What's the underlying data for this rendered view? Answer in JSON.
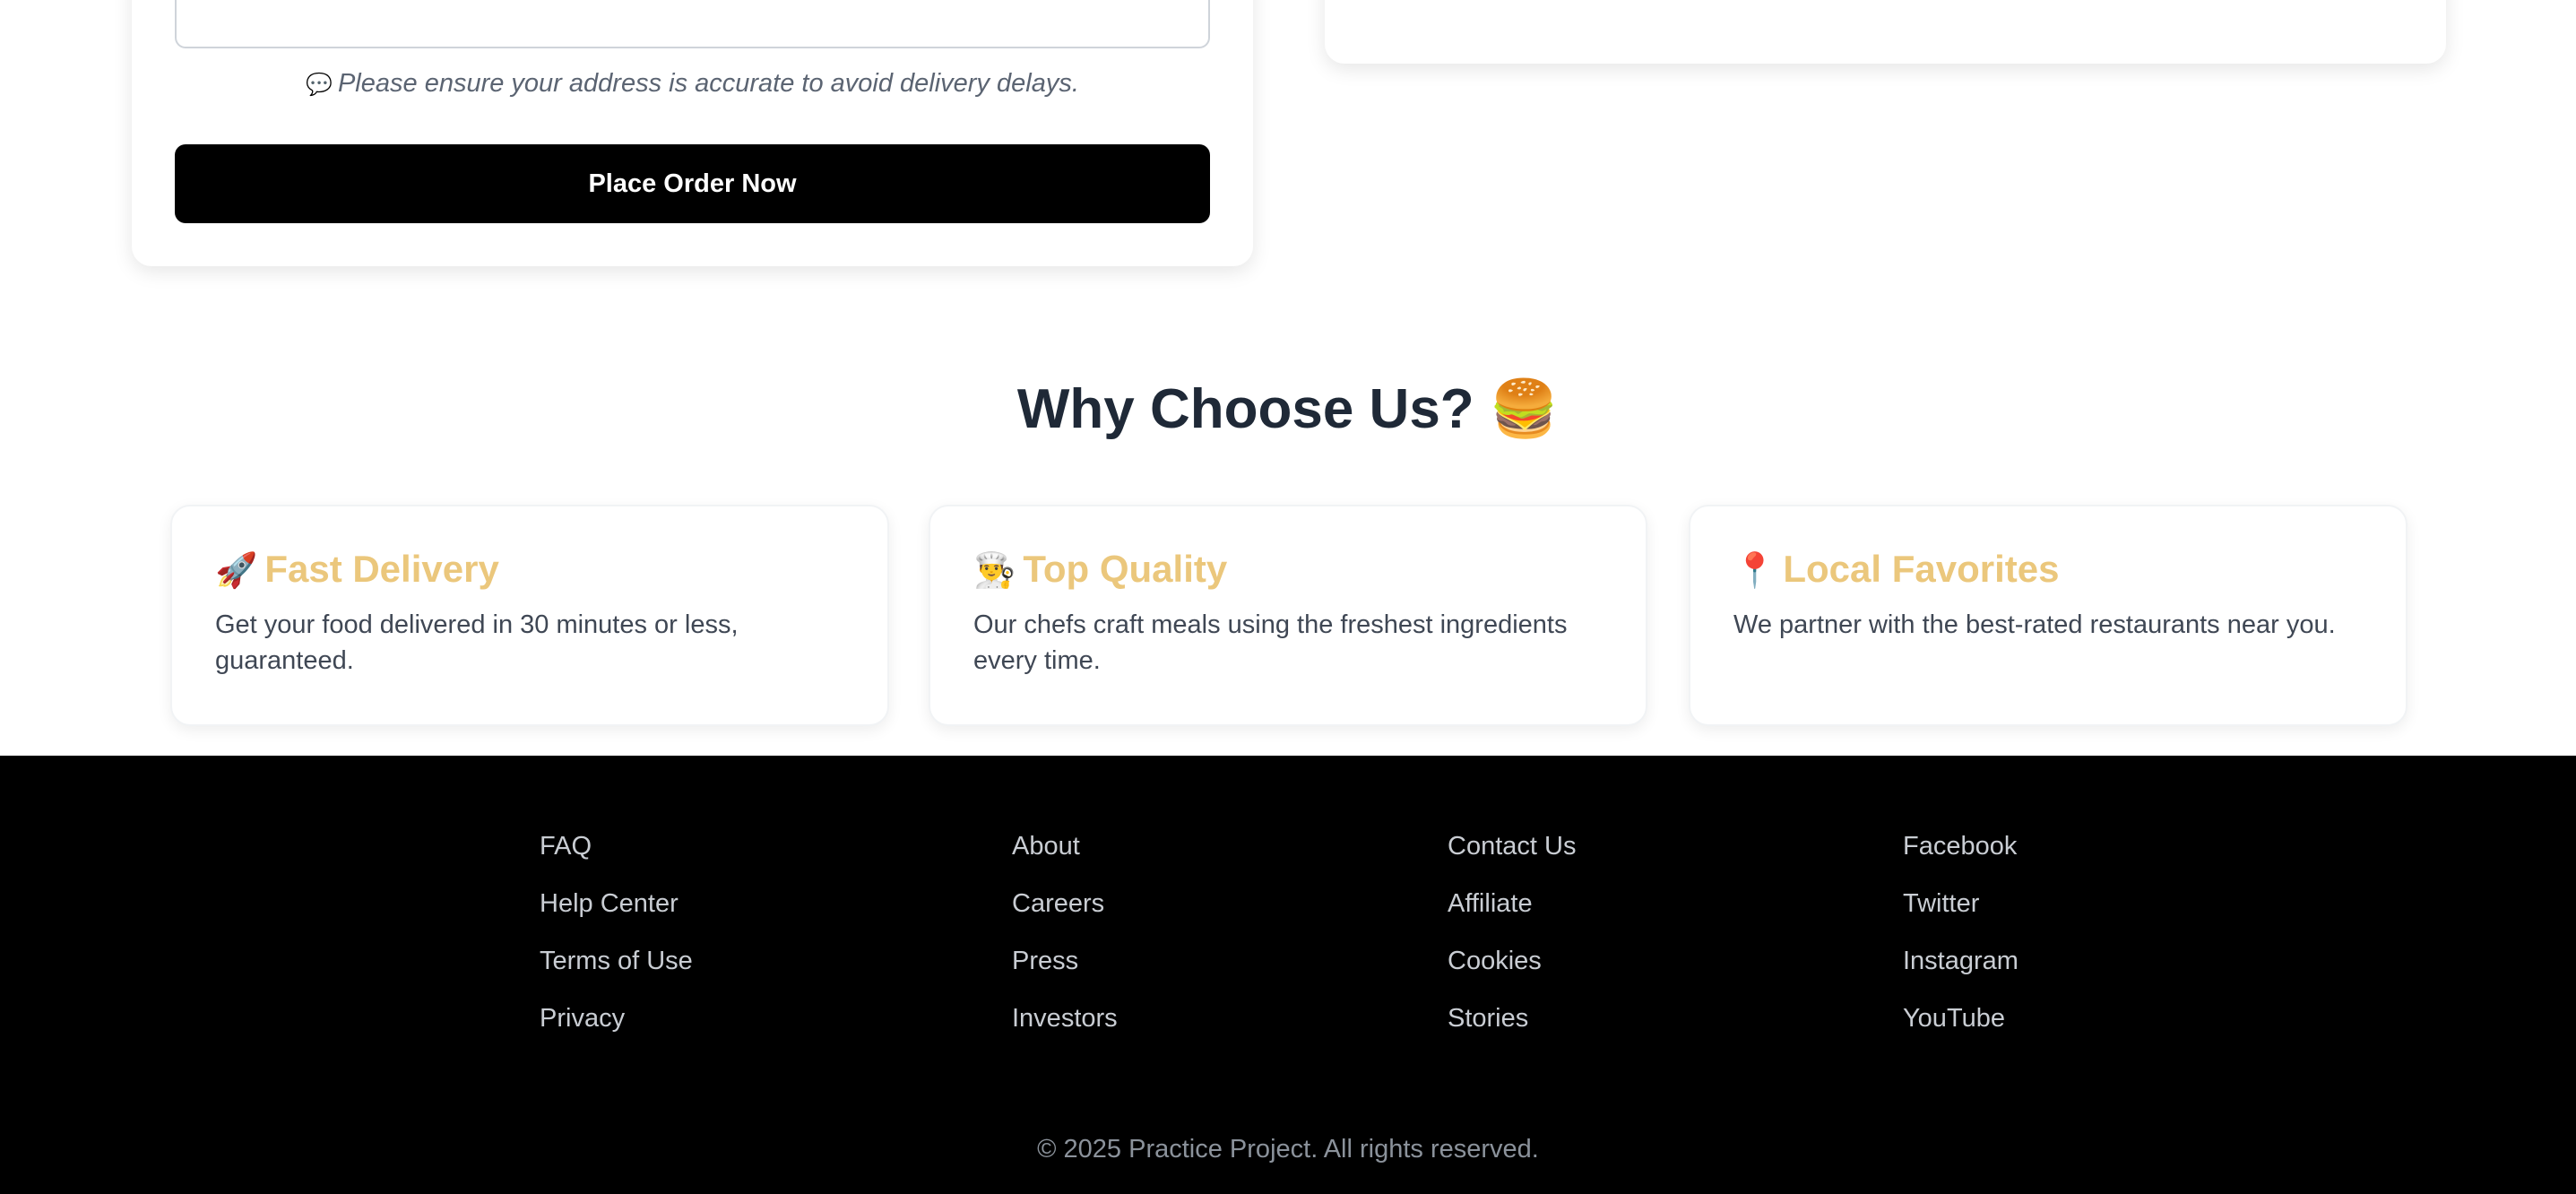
{
  "order_form": {
    "address_value": "",
    "note_icon": "speech-balloon-icon",
    "note_emoji": "💬",
    "note": "Please ensure your address is accurate to avoid delivery delays.",
    "submit_label": "Place Order Now"
  },
  "why_choose_us": {
    "title": "Why Choose Us?",
    "title_emoji": "🍔",
    "features": [
      {
        "icon": "rocket-icon",
        "emoji": "🚀",
        "title": "Fast Delivery",
        "description": "Get your food delivered in 30 minutes or less, guaranteed."
      },
      {
        "icon": "chef-icon",
        "emoji": "👨‍🍳",
        "title": "Top Quality",
        "description": "Our chefs craft meals using the freshest ingredients every time."
      },
      {
        "icon": "pin-icon",
        "emoji": "📍",
        "title": "Local Favorites",
        "description": "We partner with the best-rated restaurants near you."
      }
    ]
  },
  "footer": {
    "columns": [
      {
        "links": [
          "FAQ",
          "Help Center",
          "Terms of Use",
          "Privacy"
        ]
      },
      {
        "links": [
          "About",
          "Careers",
          "Press",
          "Investors"
        ]
      },
      {
        "links": [
          "Contact Us",
          "Affiliate",
          "Cookies",
          "Stories"
        ]
      },
      {
        "links": [
          "Facebook",
          "Twitter",
          "Instagram",
          "YouTube"
        ]
      }
    ],
    "copyright": "© 2025 Practice Project. All rights reserved."
  },
  "colors": {
    "feature_title": "#ebc77c",
    "footer_bg": "#000000",
    "button_bg": "#000000"
  }
}
